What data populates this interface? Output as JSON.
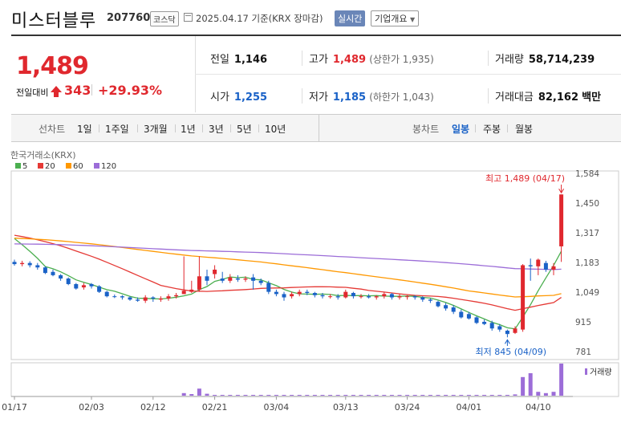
{
  "header": {
    "name": "미스터블루",
    "code": "207760",
    "market": "코스닥",
    "date": "2025.04.17 기준(KRX 장마감)",
    "realtime": "실시간",
    "overview": "기업개요"
  },
  "price": {
    "current": "1,489",
    "change_label": "전일대비",
    "change": "343",
    "pct": "+29.93%"
  },
  "quote": {
    "prev_label": "전일",
    "prev": "1,146",
    "high_label": "고가",
    "high": "1,489",
    "upper_label": "(상한가 1,935)",
    "volume_label": "거래량",
    "volume": "58,714,239",
    "open_label": "시가",
    "open": "1,255",
    "low_label": "저가",
    "low": "1,185",
    "lower_label": "(하한가 1,043)",
    "amount_label": "거래대금",
    "amount": "82,162",
    "amount_unit": "백만"
  },
  "toolbar": {
    "line_label": "선차트",
    "periods": [
      "1일",
      "1주일",
      "3개월",
      "1년",
      "3년",
      "5년",
      "10년"
    ],
    "candle_label": "봉차트",
    "candles": [
      "일봉",
      "주봉",
      "월봉"
    ],
    "selected_candle": "일봉"
  },
  "chart_data": {
    "type": "candlestick",
    "source": "한국거래소(KRX)",
    "legend": [
      {
        "name": "5",
        "color": "#4caf50"
      },
      {
        "name": "20",
        "color": "#e53935"
      },
      {
        "name": "60",
        "color": "#ff9800"
      },
      {
        "name": "120",
        "color": "#9c6dd8"
      }
    ],
    "y_ticks": [
      1584,
      1450,
      1317,
      1183,
      1049,
      915,
      781
    ],
    "x_ticks": [
      "01/17",
      "02/03",
      "02/12",
      "02/21",
      "03/04",
      "03/13",
      "03/24",
      "04/01",
      "04/10"
    ],
    "x_tick_index": [
      0,
      10,
      18,
      26,
      34,
      43,
      51,
      59,
      68
    ],
    "high_annotation": "최고 1,489 (04/17)",
    "low_annotation": "최저 845 (04/09)",
    "volume_label": "거래량",
    "candles": [
      [
        1185,
        1175,
        1195,
        1168
      ],
      [
        1175,
        1180,
        1190,
        1165
      ],
      [
        1180,
        1170,
        1188,
        1160
      ],
      [
        1170,
        1160,
        1180,
        1150
      ],
      [
        1160,
        1135,
        1165,
        1130
      ],
      [
        1140,
        1125,
        1150,
        1120
      ],
      [
        1125,
        1110,
        1130,
        1100
      ],
      [
        1110,
        1085,
        1115,
        1080
      ],
      [
        1085,
        1065,
        1090,
        1060
      ],
      [
        1070,
        1080,
        1090,
        1060
      ],
      [
        1085,
        1075,
        1090,
        1065
      ],
      [
        1075,
        1050,
        1080,
        1045
      ],
      [
        1050,
        1030,
        1055,
        1025
      ],
      [
        1030,
        1028,
        1038,
        1022
      ],
      [
        1030,
        1025,
        1035,
        1015
      ],
      [
        1025,
        1015,
        1030,
        1010
      ],
      [
        1015,
        1010,
        1025,
        1005
      ],
      [
        1010,
        1025,
        1035,
        1000
      ],
      [
        1025,
        1020,
        1030,
        1005
      ],
      [
        1015,
        1020,
        1030,
        1005
      ],
      [
        1020,
        1030,
        1040,
        1010
      ],
      [
        1030,
        1035,
        1045,
        1020
      ],
      [
        1040,
        1055,
        1210,
        1040
      ],
      [
        1050,
        1060,
        1100,
        1045
      ],
      [
        1060,
        1120,
        1210,
        1050
      ],
      [
        1120,
        1100,
        1150,
        1080
      ],
      [
        1130,
        1150,
        1170,
        1110
      ],
      [
        1110,
        1100,
        1140,
        1090
      ],
      [
        1100,
        1115,
        1130,
        1090
      ],
      [
        1110,
        1105,
        1125,
        1095
      ],
      [
        1105,
        1110,
        1120,
        1095
      ],
      [
        1115,
        1100,
        1130,
        1060
      ],
      [
        1100,
        1090,
        1110,
        1080
      ],
      [
        1090,
        1050,
        1100,
        1040
      ],
      [
        1050,
        1040,
        1060,
        1030
      ],
      [
        1040,
        1025,
        1050,
        1010
      ],
      [
        1030,
        1040,
        1050,
        1020
      ],
      [
        1040,
        1050,
        1060,
        1030
      ],
      [
        1050,
        1045,
        1060,
        1035
      ],
      [
        1045,
        1035,
        1050,
        1025
      ],
      [
        1035,
        1030,
        1045,
        1020
      ],
      [
        1030,
        1030,
        1040,
        1020
      ],
      [
        1030,
        1025,
        1040,
        1015
      ],
      [
        1025,
        1050,
        1060,
        1020
      ],
      [
        1045,
        1030,
        1050,
        1020
      ],
      [
        1030,
        1030,
        1040,
        1020
      ],
      [
        1030,
        1025,
        1040,
        1020
      ],
      [
        1025,
        1030,
        1035,
        1015
      ],
      [
        1030,
        1040,
        1050,
        1020
      ],
      [
        1040,
        1025,
        1045,
        1015
      ],
      [
        1025,
        1030,
        1040,
        1015
      ],
      [
        1030,
        1030,
        1035,
        1015
      ],
      [
        1030,
        1025,
        1035,
        1015
      ],
      [
        1025,
        1015,
        1030,
        1005
      ],
      [
        1015,
        1010,
        1020,
        1000
      ],
      [
        1005,
        985,
        1010,
        980
      ],
      [
        990,
        975,
        1000,
        965
      ],
      [
        980,
        960,
        990,
        950
      ],
      [
        960,
        935,
        970,
        930
      ],
      [
        950,
        930,
        960,
        925
      ],
      [
        935,
        910,
        940,
        905
      ],
      [
        915,
        905,
        925,
        900
      ],
      [
        910,
        885,
        920,
        875
      ],
      [
        895,
        880,
        905,
        870
      ],
      [
        875,
        860,
        880,
        845
      ],
      [
        865,
        885,
        895,
        860
      ],
      [
        880,
        1170,
        1175,
        870
      ],
      [
        1170,
        1165,
        1200,
        1100
      ],
      [
        1165,
        1195,
        1200,
        1125
      ],
      [
        1180,
        1150,
        1190,
        1140
      ],
      [
        1150,
        1165,
        1180,
        1125
      ],
      [
        1255,
        1489,
        1489,
        1185
      ]
    ],
    "volume": [
      0,
      0,
      0,
      0,
      0,
      0,
      0,
      0,
      0,
      0,
      0,
      0,
      0,
      0,
      0,
      0,
      0,
      0,
      0,
      0,
      0,
      0,
      0.08,
      0.05,
      0.22,
      0.06,
      0.02,
      0.02,
      0.02,
      0.01,
      0.02,
      0.02,
      0.01,
      0.01,
      0.01,
      0.01,
      0.01,
      0.01,
      0.01,
      0.01,
      0.01,
      0.01,
      0.01,
      0.01,
      0.01,
      0.01,
      0.01,
      0.01,
      0.01,
      0.01,
      0.01,
      0.01,
      0.01,
      0.01,
      0.01,
      0.01,
      0.01,
      0.01,
      0.01,
      0.01,
      0.01,
      0.01,
      0.01,
      0.01,
      0.02,
      0.04,
      0.58,
      0.7,
      0.12,
      0.08,
      0.12,
      1.0
    ]
  }
}
